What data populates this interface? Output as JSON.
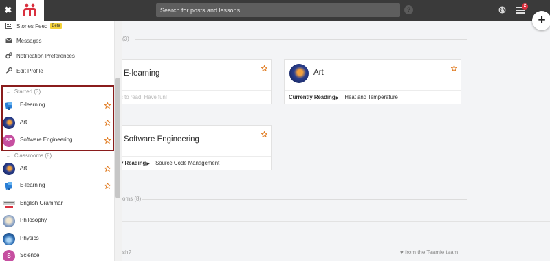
{
  "topbar": {
    "search_placeholder": "Search for posts and lessons",
    "help_glyph": "?",
    "notification_count": "2",
    "add_glyph": "+",
    "close_glyph": "✖"
  },
  "main": {
    "starred_section_count": "(3)",
    "classrooms_section_label": "oms (8)",
    "cards": [
      {
        "title": "E-learning",
        "footer_text": "s to read. Have fun!"
      },
      {
        "title": "Art",
        "footer_label": "Currently Reading",
        "footer_value": "Heat and Temperature"
      },
      {
        "title": "Software Engineering",
        "footer_label": "y Reading",
        "footer_value": "Source Code Management"
      }
    ],
    "footer_left": "sh?",
    "footer_right": "from the Teamie team"
  },
  "sidebar": {
    "menu": [
      {
        "label": "Stories Feed",
        "badge": "Beta",
        "icon": "stories-icon"
      },
      {
        "label": "Messages",
        "icon": "envelope-icon"
      },
      {
        "label": "Notification Preferences",
        "icon": "gears-icon"
      },
      {
        "label": "Edit Profile",
        "icon": "wrench-icon"
      }
    ],
    "starred": {
      "heading": "Starred (3)",
      "items": [
        {
          "label": "E-learning"
        },
        {
          "label": "Art"
        },
        {
          "label": "Software Engineering",
          "initials": "SE"
        }
      ]
    },
    "classrooms": {
      "heading": "Classrooms (8)",
      "items": [
        {
          "label": "Art",
          "starred": true
        },
        {
          "label": "E-learning",
          "starred": true
        },
        {
          "label": "English Grammar"
        },
        {
          "label": "Philosophy"
        },
        {
          "label": "Physics"
        },
        {
          "label": "Science",
          "initials": "S"
        }
      ]
    }
  },
  "colors": {
    "topbar": "#3a3a3a",
    "brand_red": "#d9303e",
    "star_orange": "#e07a1f",
    "highlight_border": "#8a1c1c"
  }
}
